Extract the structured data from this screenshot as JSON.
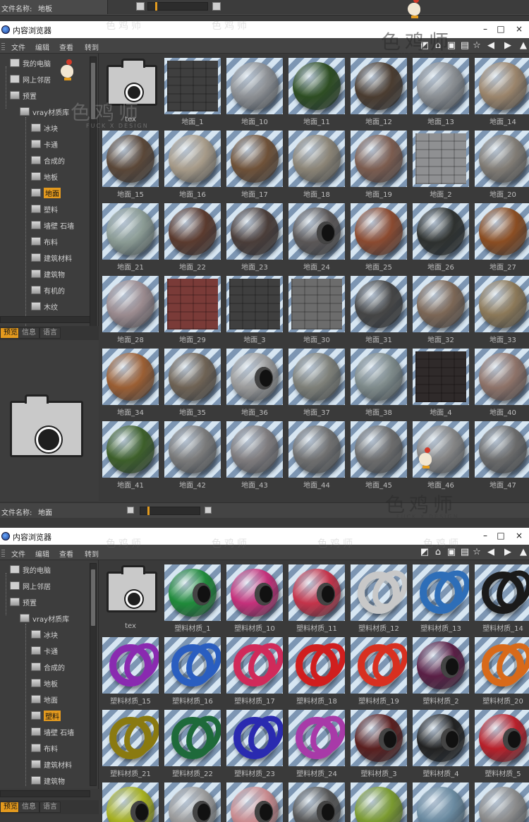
{
  "top_strip": {
    "file_label": "文件名称:",
    "file_value": "地板"
  },
  "window": {
    "title": "内容浏览器",
    "minimize": "–",
    "maximize": "□",
    "close": "×"
  },
  "menu": [
    "文件",
    "编辑",
    "查看",
    "转到"
  ],
  "tabs": [
    "预览",
    "信息",
    "语言"
  ],
  "watermark": {
    "brand": "色鸡师",
    "sub": "FUCK X DESIGN"
  },
  "panel1": {
    "tree": [
      {
        "label": "我的电脑",
        "icon": "computer-icon"
      },
      {
        "label": "网上邻居",
        "icon": "network-icon"
      },
      {
        "label": "预置",
        "icon": "folder-icon"
      },
      {
        "label": "vray材质库",
        "icon": "folder-icon"
      },
      {
        "label": "冰块",
        "icon": "folder-icon"
      },
      {
        "label": "卡通",
        "icon": "folder-icon"
      },
      {
        "label": "合成的",
        "icon": "folder-icon"
      },
      {
        "label": "地板",
        "icon": "folder-icon"
      },
      {
        "label": "地面",
        "icon": "folder-icon",
        "selected": true
      },
      {
        "label": "塑料",
        "icon": "folder-icon"
      },
      {
        "label": "墙壁 石墙",
        "icon": "folder-icon"
      },
      {
        "label": "布料",
        "icon": "folder-icon"
      },
      {
        "label": "建筑材料",
        "icon": "folder-icon"
      },
      {
        "label": "建筑物",
        "icon": "folder-icon"
      },
      {
        "label": "有机的",
        "icon": "folder-icon"
      },
      {
        "label": "木纹",
        "icon": "folder-icon"
      }
    ],
    "footer": {
      "file_label": "文件名称:",
      "file_value": "地面"
    },
    "items": [
      {
        "label": "tex",
        "kind": "lock"
      },
      {
        "label": "地面_1",
        "kind": "square",
        "color": "#3f3f3f"
      },
      {
        "label": "地面_10",
        "kind": "sphere",
        "color": "#8c8f93"
      },
      {
        "label": "地面_11",
        "kind": "sphere",
        "color": "#2d4d22"
      },
      {
        "label": "地面_12",
        "kind": "sphere",
        "color": "#4a3c30"
      },
      {
        "label": "地面_13",
        "kind": "sphere",
        "color": "#8a8e92"
      },
      {
        "label": "地面_14",
        "kind": "sphere",
        "color": "#9a846b"
      },
      {
        "label": "地面_15",
        "kind": "sphere",
        "color": "#5a4738"
      },
      {
        "label": "地面_16",
        "kind": "sphere",
        "color": "#a69a88"
      },
      {
        "label": "地面_17",
        "kind": "sphere",
        "color": "#6e5138"
      },
      {
        "label": "地面_18",
        "kind": "sphere",
        "color": "#8a8375"
      },
      {
        "label": "地面_19",
        "kind": "sphere",
        "color": "#7b5c4f"
      },
      {
        "label": "地面_2",
        "kind": "square",
        "color": "#8f9092"
      },
      {
        "label": "地面_20",
        "kind": "sphere",
        "color": "#807b74"
      },
      {
        "label": "地面_21",
        "kind": "sphere",
        "color": "#8a9a93"
      },
      {
        "label": "地面_22",
        "kind": "sphere",
        "color": "#5a3a2e"
      },
      {
        "label": "地面_23",
        "kind": "sphere",
        "color": "#4a3d39"
      },
      {
        "label": "地面_24",
        "kind": "ringsphere",
        "color": "#5a5656"
      },
      {
        "label": "地面_25",
        "kind": "sphere",
        "color": "#8a4a30"
      },
      {
        "label": "地面_26",
        "kind": "sphere",
        "color": "#2e312f"
      },
      {
        "label": "地面_27",
        "kind": "sphere",
        "color": "#8a4d22"
      },
      {
        "label": "地面_28",
        "kind": "sphere",
        "color": "#9a8a8e"
      },
      {
        "label": "地面_29",
        "kind": "square",
        "color": "#7a3b38"
      },
      {
        "label": "地面_3",
        "kind": "square",
        "color": "#3f3f3f"
      },
      {
        "label": "地面_30",
        "kind": "square",
        "color": "#6c6c6c"
      },
      {
        "label": "地面_31",
        "kind": "sphere",
        "color": "#454545"
      },
      {
        "label": "地面_32",
        "kind": "sphere",
        "color": "#7b6655"
      },
      {
        "label": "地面_33",
        "kind": "sphere",
        "color": "#8b7858"
      },
      {
        "label": "地面_34",
        "kind": "sphere",
        "color": "#9a5e33"
      },
      {
        "label": "地面_35",
        "kind": "sphere",
        "color": "#6e6254"
      },
      {
        "label": "地面_36",
        "kind": "ringsphere",
        "color": "#9a9a9a"
      },
      {
        "label": "地面_37",
        "kind": "sphere",
        "color": "#7d7f78"
      },
      {
        "label": "地面_38",
        "kind": "sphere",
        "color": "#7e8a8a"
      },
      {
        "label": "地面_4",
        "kind": "square",
        "color": "#2f2a2a"
      },
      {
        "label": "地面_40",
        "kind": "sphere",
        "color": "#8d7268"
      },
      {
        "label": "地面_41",
        "kind": "sphere",
        "color": "#3d5f2a"
      },
      {
        "label": "地面_42",
        "kind": "sphere",
        "color": "#7a7a7a"
      },
      {
        "label": "地面_43",
        "kind": "sphere",
        "color": "#7e7b7d"
      },
      {
        "label": "地面_44",
        "kind": "sphere",
        "color": "#6f6f6f"
      },
      {
        "label": "地面_45",
        "kind": "sphere",
        "color": "#6c6c6c"
      },
      {
        "label": "地面_46",
        "kind": "sphere",
        "color": "#858585"
      },
      {
        "label": "地面_47",
        "kind": "sphere",
        "color": "#6a6a6a"
      }
    ]
  },
  "panel2": {
    "tree": [
      {
        "label": "我的电脑",
        "icon": "computer-icon"
      },
      {
        "label": "网上邻居",
        "icon": "network-icon"
      },
      {
        "label": "预置",
        "icon": "folder-icon"
      },
      {
        "label": "vray材质库",
        "icon": "folder-icon"
      },
      {
        "label": "冰块",
        "icon": "folder-icon"
      },
      {
        "label": "卡通",
        "icon": "folder-icon"
      },
      {
        "label": "合成的",
        "icon": "folder-icon"
      },
      {
        "label": "地板",
        "icon": "folder-icon"
      },
      {
        "label": "地面",
        "icon": "folder-icon"
      },
      {
        "label": "塑料",
        "icon": "folder-icon",
        "selected": true
      },
      {
        "label": "墙壁 石墙",
        "icon": "folder-icon"
      },
      {
        "label": "布料",
        "icon": "folder-icon"
      },
      {
        "label": "建筑材料",
        "icon": "folder-icon"
      },
      {
        "label": "建筑物",
        "icon": "folder-icon"
      }
    ],
    "items": [
      {
        "label": "tex",
        "kind": "lock"
      },
      {
        "label": "塑料材质_1",
        "kind": "ringsphere",
        "color": "#1f8a3a"
      },
      {
        "label": "塑料材质_10",
        "kind": "ringsphere",
        "color": "#c4307a"
      },
      {
        "label": "塑料材质_11",
        "kind": "ringsphere",
        "color": "#c4334a"
      },
      {
        "label": "塑料材质_12",
        "kind": "knot",
        "color": "#c8c8c8"
      },
      {
        "label": "塑料材质_13",
        "kind": "knot",
        "color": "#2e6eb8"
      },
      {
        "label": "塑料材质_14",
        "kind": "knot",
        "color": "#1a1a1a"
      },
      {
        "label": "塑料材质_15",
        "kind": "knot",
        "color": "#8a2ab0"
      },
      {
        "label": "塑料材质_16",
        "kind": "knot",
        "color": "#2a5ec0"
      },
      {
        "label": "塑料材质_17",
        "kind": "knot",
        "color": "#d02a5a"
      },
      {
        "label": "塑料材质_18",
        "kind": "knot",
        "color": "#d01e1e"
      },
      {
        "label": "塑料材质_19",
        "kind": "knot",
        "color": "#d83020"
      },
      {
        "label": "塑料材质_2",
        "kind": "ringsphere",
        "color": "#5a1f45"
      },
      {
        "label": "塑料材质_20",
        "kind": "knot",
        "color": "#d86a1a"
      },
      {
        "label": "塑料材质_21",
        "kind": "knot",
        "color": "#8a7a10"
      },
      {
        "label": "塑料材质_22",
        "kind": "knot",
        "color": "#1e6a3a"
      },
      {
        "label": "塑料材质_23",
        "kind": "knot",
        "color": "#2a2ab0"
      },
      {
        "label": "塑料材质_24",
        "kind": "knot",
        "color": "#a83aa8"
      },
      {
        "label": "塑料材质_3",
        "kind": "ringsphere",
        "color": "#5a1f1f"
      },
      {
        "label": "塑料材质_4",
        "kind": "ringsphere",
        "color": "#222222"
      },
      {
        "label": "塑料材质_5",
        "kind": "ringsphere",
        "color": "#b8202a"
      },
      {
        "label": "",
        "kind": "ringsphere",
        "color": "#a6b020"
      },
      {
        "label": "",
        "kind": "ringsphere",
        "color": "#9a9a9a"
      },
      {
        "label": "",
        "kind": "ringsphere",
        "color": "#c88a8e"
      },
      {
        "label": "",
        "kind": "ringsphere",
        "color": "#555555"
      },
      {
        "label": "",
        "kind": "sphere",
        "color": "#7a9a30"
      },
      {
        "label": "",
        "kind": "sphere",
        "color": "#6a8aa0"
      },
      {
        "label": "",
        "kind": "sphere",
        "color": "#8a8a8a"
      }
    ]
  }
}
